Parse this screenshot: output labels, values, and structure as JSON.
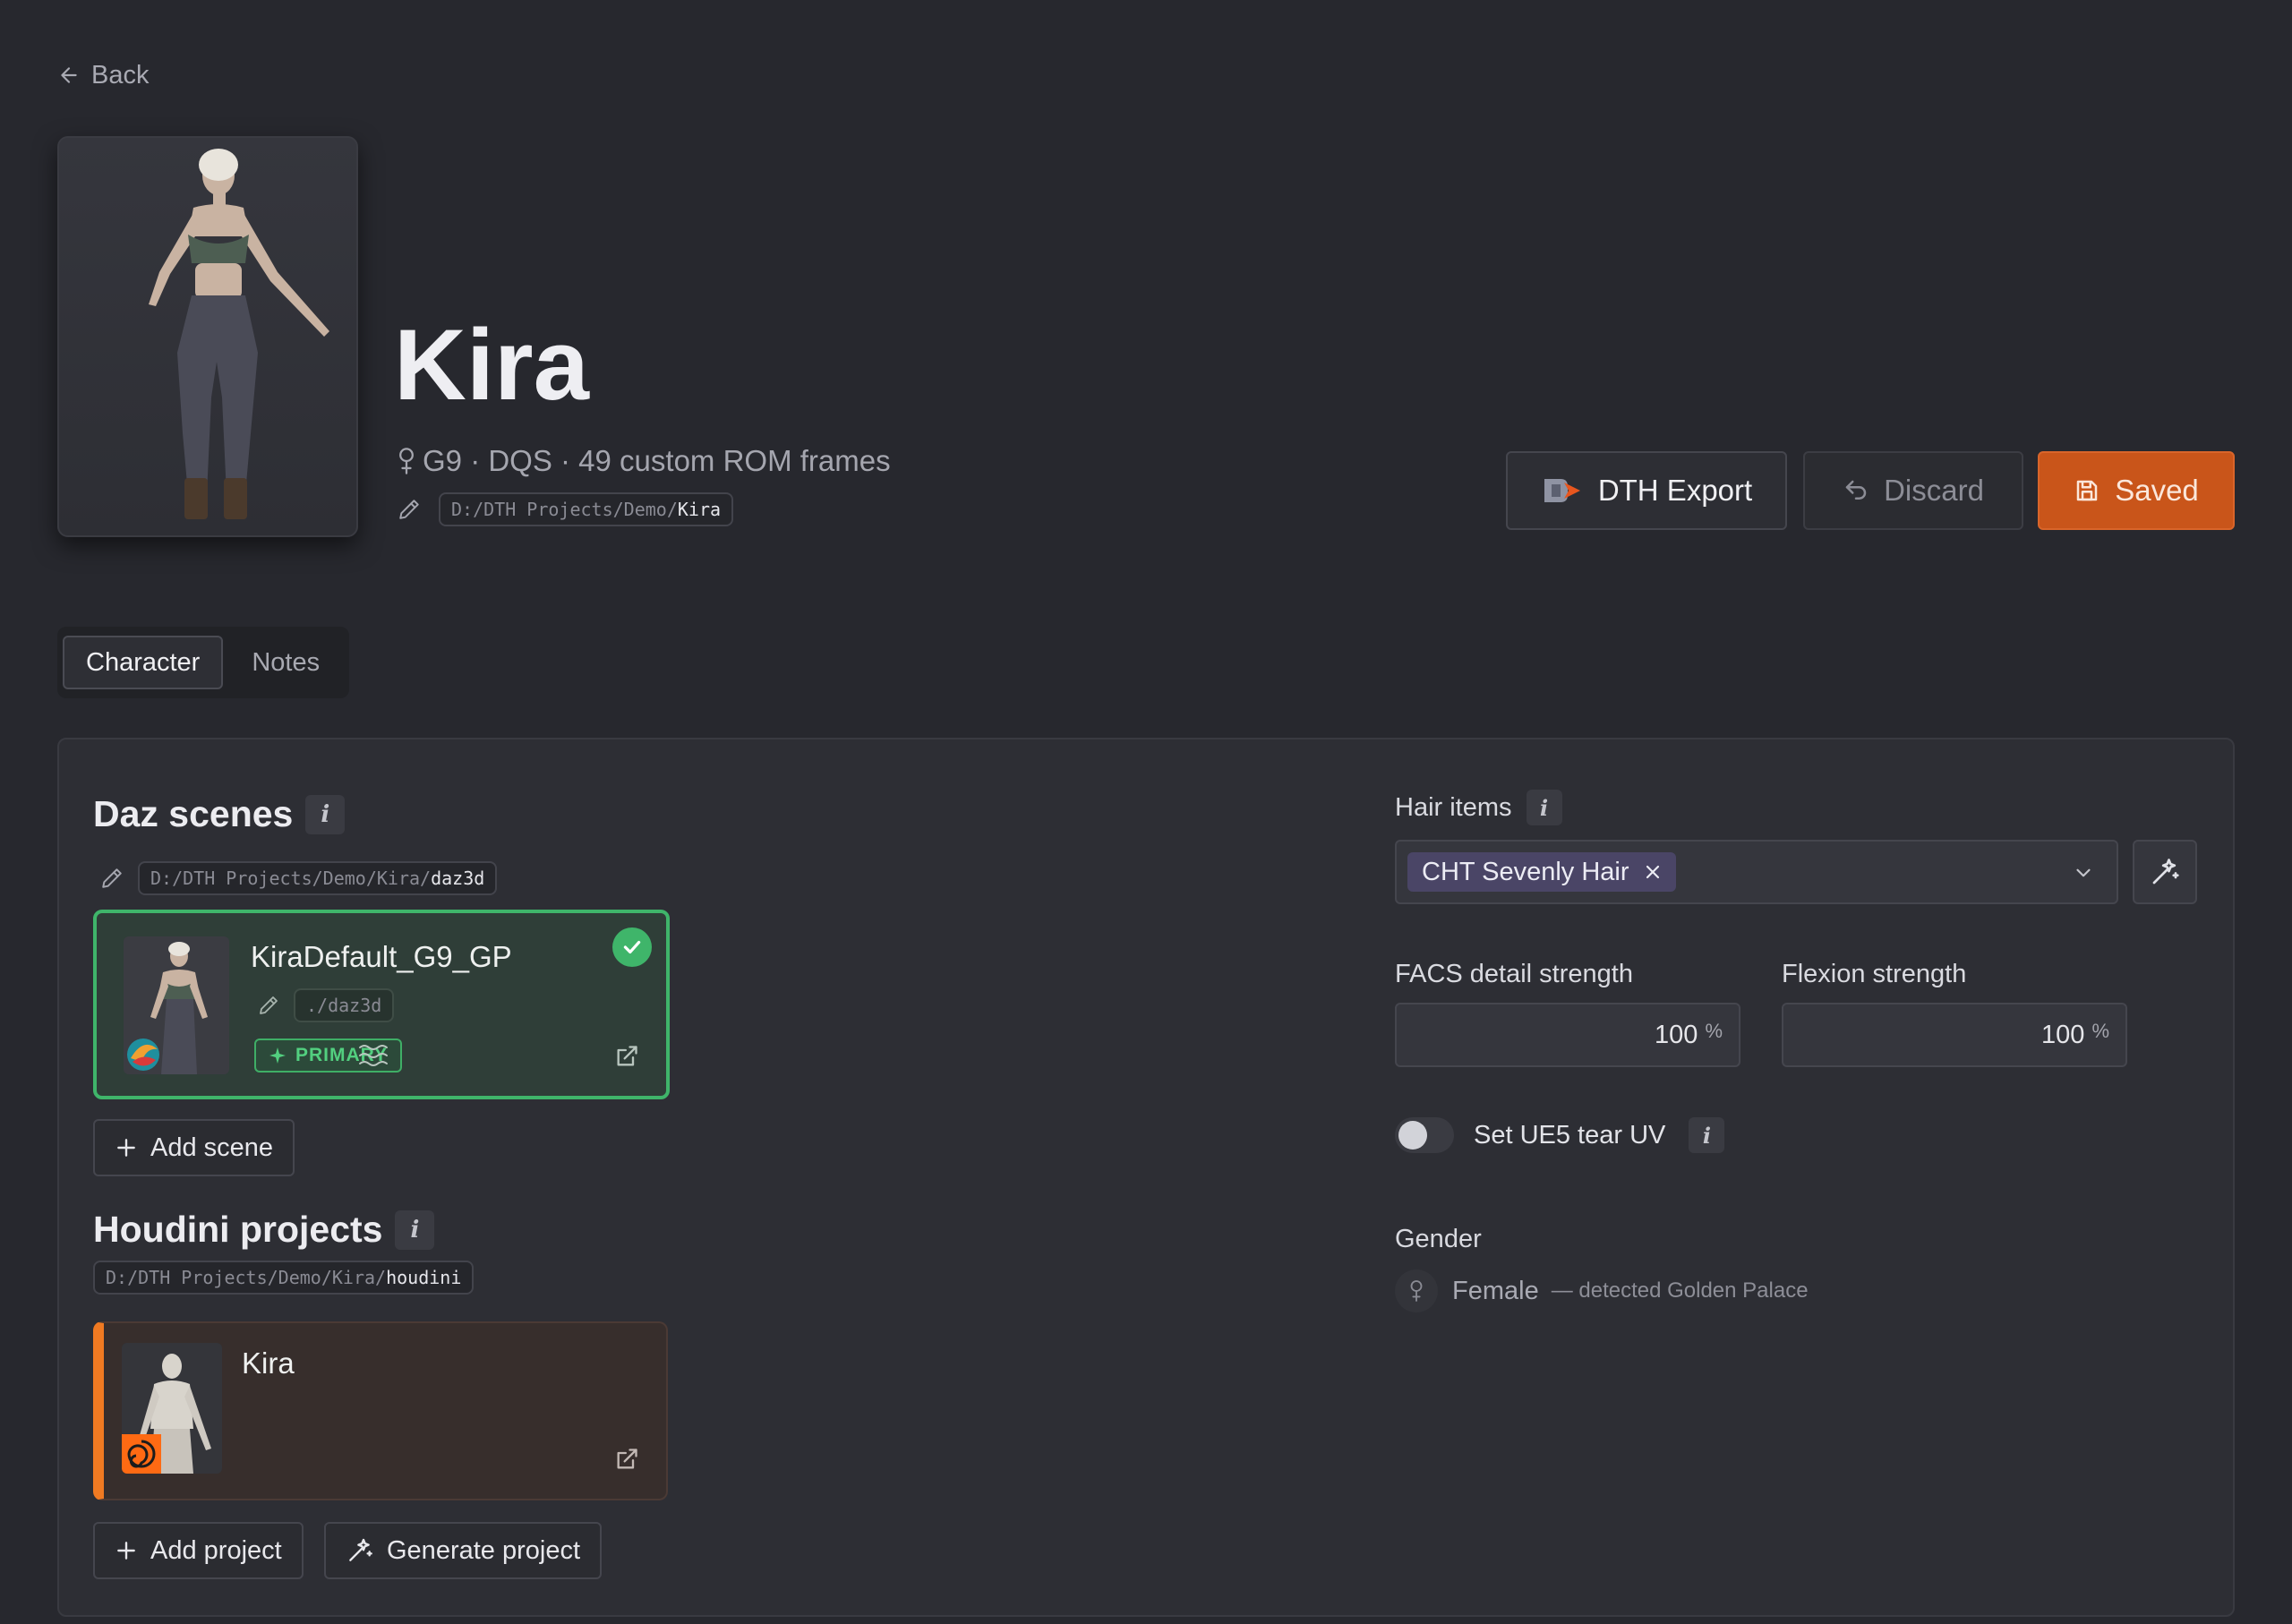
{
  "nav": {
    "back_label": "Back"
  },
  "header": {
    "name": "Kira",
    "meta": "G9 · DQS · 49 custom ROM frames",
    "path_prefix": "D:/DTH Projects/Demo/",
    "path_leaf": "Kira"
  },
  "actions": {
    "export_label": "DTH Export",
    "discard_label": "Discard",
    "saved_label": "Saved"
  },
  "tabs": [
    {
      "label": "Character",
      "active": true
    },
    {
      "label": "Notes",
      "active": false
    }
  ],
  "daz": {
    "title": "Daz scenes",
    "path_prefix": "D:/DTH Projects/Demo/Kira/",
    "path_leaf": "daz3d",
    "scenes": [
      {
        "name": "KiraDefault_G9_GP",
        "path": "./daz3d",
        "badge": "PRIMARY",
        "selected": true
      }
    ],
    "add_label": "Add scene"
  },
  "houdini": {
    "title": "Houdini projects",
    "path_prefix": "D:/DTH Projects/Demo/Kira/",
    "path_leaf": "houdini",
    "projects": [
      {
        "name": "Kira"
      }
    ],
    "add_label": "Add project",
    "generate_label": "Generate project"
  },
  "settings": {
    "hair_label": "Hair items",
    "hair_tags": [
      "CHT Sevenly Hair"
    ],
    "facs_label": "FACS detail strength",
    "facs_value": "100",
    "flexion_label": "Flexion strength",
    "flexion_value": "100",
    "unit": "%",
    "tear_uv_label": "Set UE5 tear UV",
    "tear_uv_on": false,
    "gender_label": "Gender",
    "gender_value": "Female",
    "gender_note": "— detected Golden Palace"
  },
  "colors": {
    "accent_orange": "#c9551a",
    "success_green": "#3fb56a",
    "houdini_orange": "#f07a22",
    "tag_purple": "#4a4566"
  },
  "icons": [
    "arrow-left-icon",
    "female-icon",
    "pencil-icon",
    "dth-logo-icon",
    "undo-icon",
    "save-icon",
    "check-icon",
    "sparkle-icon",
    "waves-icon",
    "external-link-icon",
    "plus-icon",
    "close-icon",
    "chevron-down-icon",
    "magic-wand-icon",
    "daz-logo-icon",
    "houdini-logo-icon"
  ]
}
